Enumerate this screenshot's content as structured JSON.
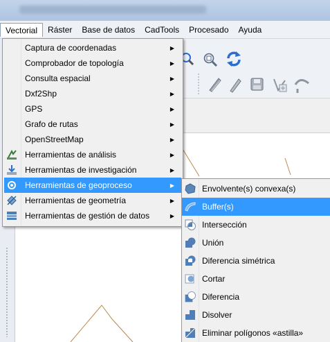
{
  "menubar": {
    "items": [
      "Vectorial",
      "Ráster",
      "Base de datos",
      "CadTools",
      "Procesado",
      "Ayuda"
    ],
    "active_index": 0
  },
  "vector_menu": {
    "items": [
      {
        "label": "Captura de coordenadas",
        "icon": "none",
        "submenu": true
      },
      {
        "label": "Comprobador de topología",
        "icon": "none",
        "submenu": true
      },
      {
        "label": "Consulta espacial",
        "icon": "none",
        "submenu": true
      },
      {
        "label": "Dxf2Shp",
        "icon": "none",
        "submenu": true
      },
      {
        "label": "GPS",
        "icon": "none",
        "submenu": true
      },
      {
        "label": "Grafo de rutas",
        "icon": "none",
        "submenu": true
      },
      {
        "label": "OpenStreetMap",
        "icon": "none",
        "submenu": true
      },
      {
        "label": "Herramientas de análisis",
        "icon": "analysis-icon",
        "submenu": true
      },
      {
        "label": "Herramientas de investigación",
        "icon": "research-icon",
        "submenu": true
      },
      {
        "label": "Herramientas de geoproceso",
        "icon": "geoprocess-icon",
        "submenu": true,
        "highlighted": true
      },
      {
        "label": "Herramientas de geometría",
        "icon": "geometry-icon",
        "submenu": true
      },
      {
        "label": "Herramientas de gestión de datos",
        "icon": "data-management-icon",
        "submenu": true
      }
    ]
  },
  "geoprocess_submenu": {
    "items": [
      {
        "label": "Envolvente(s) convexa(s)",
        "icon": "convex-hull-icon"
      },
      {
        "label": "Buffer(s)",
        "icon": "buffer-icon",
        "highlighted": true
      },
      {
        "label": "Intersección",
        "icon": "intersect-icon"
      },
      {
        "label": "Unión",
        "icon": "union-icon"
      },
      {
        "label": "Diferencia simétrica",
        "icon": "sym-difference-icon"
      },
      {
        "label": "Cortar",
        "icon": "clip-icon"
      },
      {
        "label": "Diferencia",
        "icon": "difference-icon"
      },
      {
        "label": "Disolver",
        "icon": "dissolve-icon"
      },
      {
        "label": "Eliminar polígonos «astilla»",
        "icon": "eliminate-slivers-icon"
      }
    ]
  },
  "colors": {
    "highlight": "#3399ff",
    "menu_bg": "#f0f0f0",
    "toolbar_green": "#3a9a3a",
    "toolbar_blue": "#2a6fd0"
  }
}
